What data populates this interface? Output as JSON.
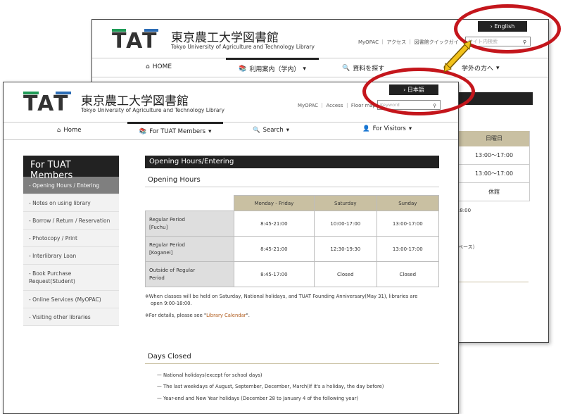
{
  "back": {
    "logo_text": "TAT",
    "title": "東京農工大学図書館",
    "subtitle": "Tokyo University of Agriculture and Technology Library",
    "util_links": "MyOPAC ｜ アクセス ｜ 図書館クイックガイ",
    "search_placeholder": "サイト内検索",
    "lang_button": "English",
    "nav": {
      "home": "HOME",
      "guide": "利用案内（学内）",
      "search": "資料を探す",
      "visitors": "学外の方へ"
    },
    "table_header": "日曜日",
    "cells": [
      "13:00～17:00",
      "13:00～17:00",
      "休館"
    ],
    "fragment_1": ":8:00",
    "fragment_2": "ベース）"
  },
  "front": {
    "logo_text": "TAT",
    "title": "東京農工大学図書館",
    "subtitle": "Tokyo University of Agriculture and Technology Library",
    "util_links": "MyOPAC ｜ Access ｜ Floor map",
    "search_placeholder": "Keyword",
    "lang_button": "日本語",
    "nav": {
      "home": "Home",
      "members": "For TUAT Members",
      "search": "Search",
      "visitors": "For Visitors"
    },
    "sidebar": {
      "heading": "For TUAT Members",
      "items": [
        "- Opening Hours / Entering",
        "- Notes on using library",
        "- Borrow / Return / Reservation",
        "- Photocopy / Print",
        "- Interlibrary Loan",
        "- Book Purchase Request(Student)",
        "- Online Services (MyOPAC)",
        "- Visiting other libraries"
      ]
    },
    "main_heading": "Opening Hours/Entering",
    "opening_heading": "Opening Hours",
    "table": {
      "headers": [
        "Monday - Friday",
        "Saturday",
        "Sunday"
      ],
      "rows": [
        {
          "label1": "Regular Period",
          "label2": "[Fuchu]",
          "cells": [
            "8:45-21:00",
            "10:00-17:00",
            "13:00-17:00"
          ]
        },
        {
          "label1": "Regular Period",
          "label2": "[Koganei]",
          "cells": [
            "8:45-21:00",
            "12:30-19:30",
            "13:00-17:00"
          ]
        },
        {
          "label1": "Outside of Regular",
          "label2": "Period",
          "cells": [
            "8:45-17:00",
            "Closed",
            "Closed"
          ]
        }
      ]
    },
    "note1": "※When classes will be held on Saturday, National holidays, and TUAT Founding Anniversary(May 31), libraries are",
    "note1b": "open 9:00-18:00.",
    "note2_pre": "※For details, please see \"",
    "note2_link": "Library Calendar",
    "note2_post": "\".",
    "days_closed_heading": "Days Closed",
    "closed_items": [
      "— National holidays(except for school days)",
      "— The last weekdays of August, September, December, March(If it's a holiday, the day before)",
      "— Year-end and New Year holidays (December 28 to January 4 of the following year)"
    ]
  },
  "colors": {
    "ring": "#c4161c",
    "arrow": "#f2c21b",
    "table_header": "#c9c0a2",
    "logo_green": "#1f9b57",
    "logo_blue": "#2c6db5"
  }
}
